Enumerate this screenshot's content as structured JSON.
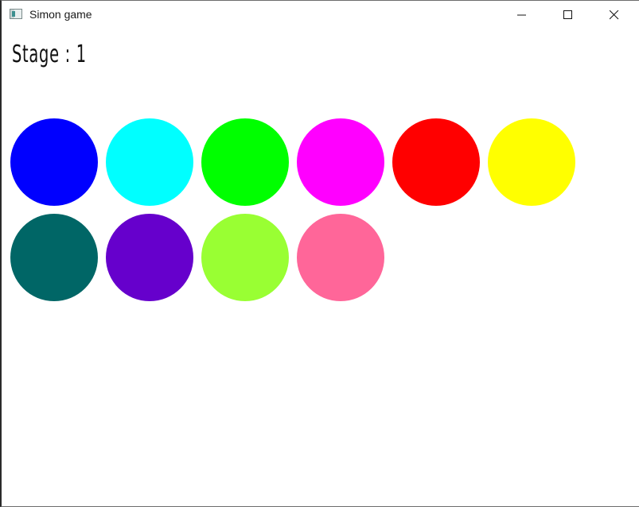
{
  "window": {
    "title": "Simon game"
  },
  "stage": {
    "text": "Stage : 1"
  },
  "circles": [
    {
      "name": "blue",
      "color": "#0000ff"
    },
    {
      "name": "cyan",
      "color": "#00ffff"
    },
    {
      "name": "green",
      "color": "#00ff00"
    },
    {
      "name": "magenta",
      "color": "#ff00ff"
    },
    {
      "name": "red",
      "color": "#ff0000"
    },
    {
      "name": "yellow",
      "color": "#ffff00"
    },
    {
      "name": "teal",
      "color": "#006666"
    },
    {
      "name": "purple",
      "color": "#6600cc"
    },
    {
      "name": "lime",
      "color": "#99ff33"
    },
    {
      "name": "pink",
      "color": "#ff6699"
    }
  ]
}
